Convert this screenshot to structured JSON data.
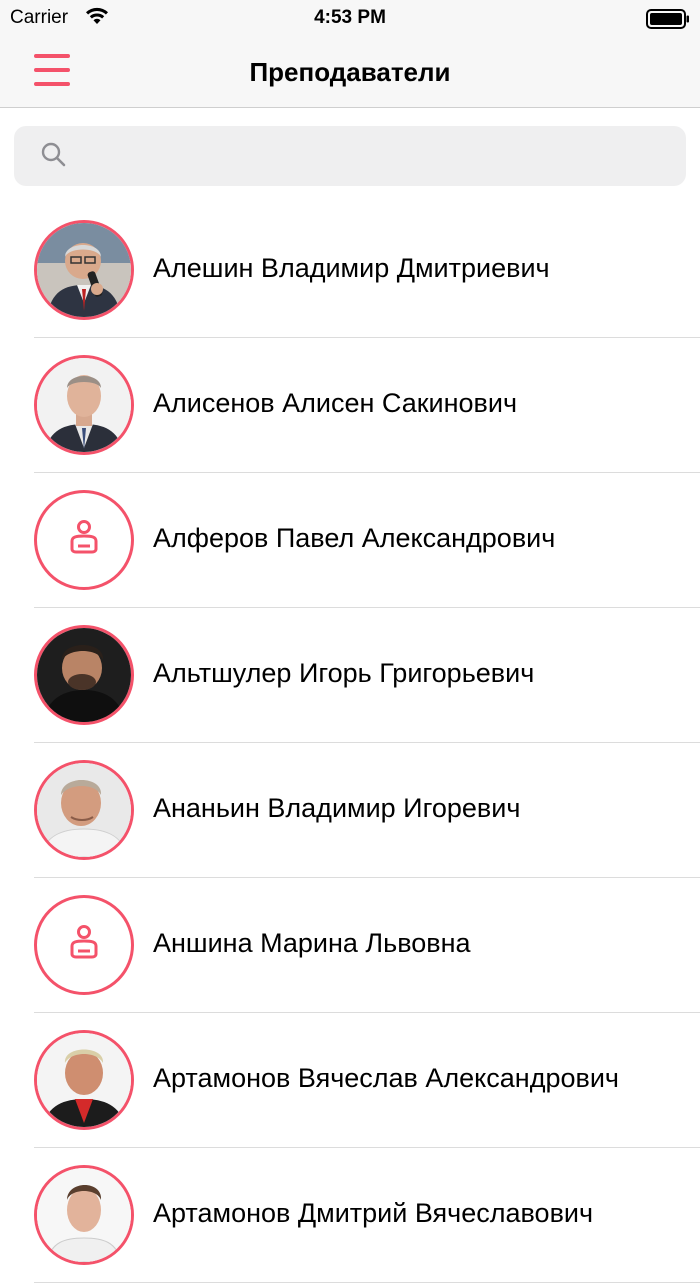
{
  "status_bar": {
    "carrier": "Carrier",
    "time": "4:53 PM"
  },
  "header": {
    "title": "Преподаватели"
  },
  "search": {
    "placeholder": ""
  },
  "colors": {
    "accent": "#f4526a",
    "separator": "#dcdcdc",
    "search_bg": "#efeff0"
  },
  "teachers": [
    {
      "name": "Алешин Владимир Дмитриевич",
      "avatar": "photo"
    },
    {
      "name": "Алисенов Алисен Сакинович",
      "avatar": "photo"
    },
    {
      "name": "Алферов Павел Александрович",
      "avatar": "person-placeholder-icon"
    },
    {
      "name": "Альтшулер Игорь Григорьевич",
      "avatar": "photo"
    },
    {
      "name": "Ананьин Владимир Игоревич",
      "avatar": "photo"
    },
    {
      "name": "Аншина Марина Львовна",
      "avatar": "person-placeholder-icon"
    },
    {
      "name": "Артамонов Вячеслав Александрович",
      "avatar": "photo"
    },
    {
      "name": "Артамонов Дмитрий Вячеславович",
      "avatar": "photo"
    }
  ]
}
